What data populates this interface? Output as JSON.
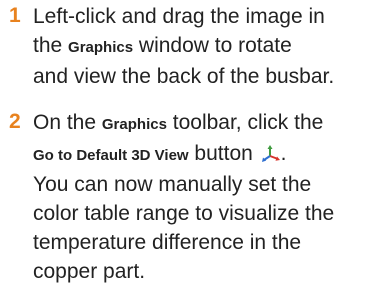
{
  "steps": [
    {
      "number": "1",
      "line1": "Left-click and drag the image in",
      "line2_pre": "the ",
      "line2_bold": "Graphics",
      "line2_post": " window to rotate",
      "line3": "and view the back of the busbar."
    },
    {
      "number": "2",
      "line1_pre": "On the ",
      "line1_bold": "Graphics",
      "line1_post": " toolbar, click the",
      "line2_bold": "Go to Default 3D View",
      "line2_post": " button ",
      "icon": "default-3d-view-axes-icon",
      "line2_end": ".",
      "line3": "You can now manually set the",
      "line4": "color table range to visualize the",
      "line5": "temperature difference in the",
      "line6": "copper part."
    }
  ],
  "colors": {
    "step_number": "#e8821e",
    "body_text": "#222222",
    "axis_x": "#d9342b",
    "axis_y": "#3f9b3f",
    "axis_z": "#2f6fd0"
  }
}
